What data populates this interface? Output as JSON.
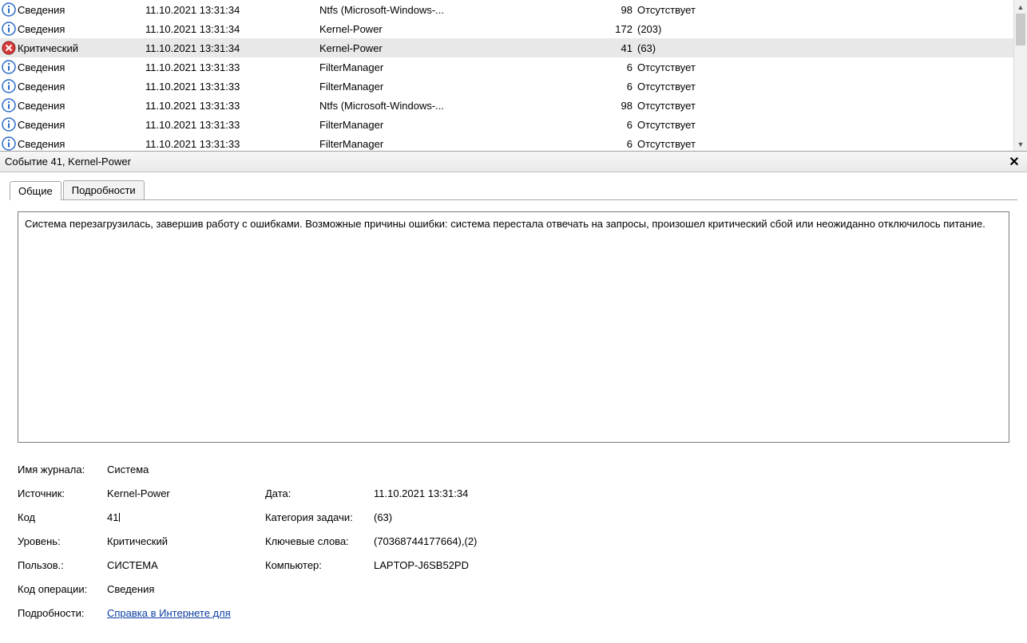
{
  "details_title": "Событие 41, Kernel-Power",
  "tabs": {
    "general": "Общие",
    "details": "Подробности"
  },
  "description": "Система перезагрузилась, завершив работу с ошибками. Возможные причины ошибки: система перестала отвечать на запросы, произошел критический сбой или неожиданно отключилось питание.",
  "labels": {
    "log_name": "Имя журнала:",
    "source": "Источник:",
    "date": "Дата:",
    "event_id": "Код",
    "task_category": "Категория задачи:",
    "level": "Уровень:",
    "keywords": "Ключевые слова:",
    "user": "Пользов.:",
    "computer": "Компьютер:",
    "opcode": "Код операции:",
    "more_info": "Подробности:"
  },
  "values": {
    "log_name": "Система",
    "source": "Kernel-Power",
    "date": "11.10.2021 13:31:34",
    "event_id": "41",
    "task_category": "(63)",
    "level": "Критический",
    "keywords": "(70368744177664),(2)",
    "user": "СИСТЕМА",
    "computer": "LAPTOP-J6SB52PD",
    "opcode": "Сведения",
    "more_info_link": "Справка в Интернете для "
  },
  "events": [
    {
      "level": "Сведения",
      "icon": "info",
      "date": "11.10.2021 13:31:34",
      "source": "Ntfs (Microsoft-Windows-...",
      "id": "98",
      "task": "Отсутствует",
      "selected": false
    },
    {
      "level": "Сведения",
      "icon": "info",
      "date": "11.10.2021 13:31:34",
      "source": "Kernel-Power",
      "id": "172",
      "task": "(203)",
      "selected": false
    },
    {
      "level": "Критический",
      "icon": "critical",
      "date": "11.10.2021 13:31:34",
      "source": "Kernel-Power",
      "id": "41",
      "task": "(63)",
      "selected": true
    },
    {
      "level": "Сведения",
      "icon": "info",
      "date": "11.10.2021 13:31:33",
      "source": "FilterManager",
      "id": "6",
      "task": "Отсутствует",
      "selected": false
    },
    {
      "level": "Сведения",
      "icon": "info",
      "date": "11.10.2021 13:31:33",
      "source": "FilterManager",
      "id": "6",
      "task": "Отсутствует",
      "selected": false
    },
    {
      "level": "Сведения",
      "icon": "info",
      "date": "11.10.2021 13:31:33",
      "source": "Ntfs (Microsoft-Windows-...",
      "id": "98",
      "task": "Отсутствует",
      "selected": false
    },
    {
      "level": "Сведения",
      "icon": "info",
      "date": "11.10.2021 13:31:33",
      "source": "FilterManager",
      "id": "6",
      "task": "Отсутствует",
      "selected": false
    },
    {
      "level": "Сведения",
      "icon": "info",
      "date": "11.10.2021 13:31:33",
      "source": "FilterManager",
      "id": "6",
      "task": "Отсутствует",
      "selected": false
    }
  ]
}
